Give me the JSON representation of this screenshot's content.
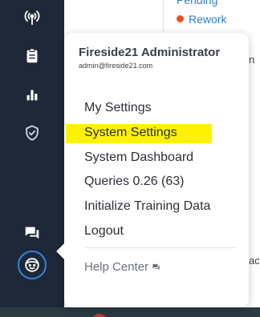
{
  "background": {
    "status_pending": "Pending",
    "status_rework": "Rework",
    "cut_text_1": "n",
    "cut_text_2": "ac"
  },
  "nav": {
    "icons": [
      "antenna-icon",
      "clipboard-icon",
      "bar-chart-icon",
      "shield-check-icon",
      "chat-icon",
      "avatar-icon"
    ]
  },
  "menu": {
    "user_name": "Fireside21 Administrator",
    "user_email": "admin@fireside21.com",
    "items": [
      {
        "label": "My Settings"
      },
      {
        "label": "System Settings"
      },
      {
        "label": "System Dashboard"
      },
      {
        "label": "Queries 0.26 (63)"
      },
      {
        "label": "Initialize Training Data"
      },
      {
        "label": "Logout"
      }
    ],
    "help_label": "Help Center",
    "highlighted_item": "System Settings"
  },
  "colors": {
    "rail": "#1e2838",
    "highlight": "#fff200",
    "accent": "#2f86e0",
    "rework_dot": "#e8531f"
  }
}
